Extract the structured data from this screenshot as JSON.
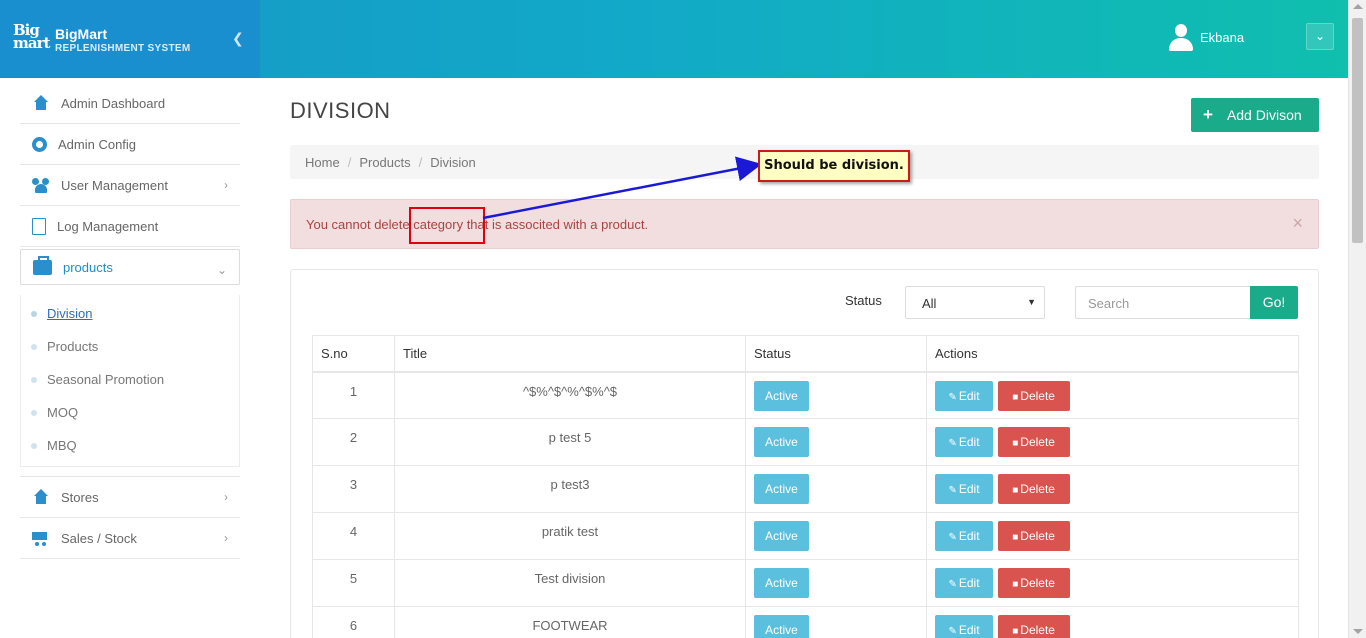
{
  "brand": {
    "logo_top": "Big",
    "logo_bottom": "mart",
    "name": "BigMart",
    "subtitle": "REPLENISHMENT SYSTEM"
  },
  "user": {
    "name": "Ekbana"
  },
  "sidebar": {
    "items": [
      {
        "label": "Admin Dashboard",
        "icon": "home-icon"
      },
      {
        "label": "Admin Config",
        "icon": "gear-icon"
      },
      {
        "label": "User Management",
        "icon": "users-icon"
      },
      {
        "label": "Log Management",
        "icon": "file-icon"
      },
      {
        "label": "products",
        "icon": "briefcase-icon"
      },
      {
        "label": "Stores",
        "icon": "home-icon"
      },
      {
        "label": "Sales / Stock",
        "icon": "cart-icon"
      }
    ],
    "submenu": [
      "Division",
      "Products",
      "Seasonal Promotion",
      "MOQ",
      "MBQ"
    ]
  },
  "page": {
    "title": "DIVISION",
    "add_button": "Add Divison"
  },
  "breadcrumb": [
    "Home",
    "Products",
    "Division"
  ],
  "alert": {
    "message": "You cannot delete category that is associted with a product."
  },
  "filters": {
    "status_label": "Status",
    "status_value": "All",
    "search_placeholder": "Search",
    "go_label": "Go!"
  },
  "table": {
    "headers": [
      "S.no",
      "Title",
      "Status",
      "Actions"
    ],
    "rows": [
      {
        "sno": "1",
        "title": "^$%^$^%^$%^$",
        "status": "Active"
      },
      {
        "sno": "2",
        "title": "p test 5",
        "status": "Active"
      },
      {
        "sno": "3",
        "title": "p test3",
        "status": "Active"
      },
      {
        "sno": "4",
        "title": "pratik test",
        "status": "Active"
      },
      {
        "sno": "5",
        "title": "Test division",
        "status": "Active"
      },
      {
        "sno": "6",
        "title": "FOOTWEAR",
        "status": "Active"
      }
    ],
    "edit_label": "Edit",
    "delete_label": "Delete"
  },
  "annotation": {
    "note": "Should be division."
  },
  "colors": {
    "accent": "#1aab8b",
    "brand": "#1a8fcf",
    "info": "#5bc0de",
    "danger": "#d9534f",
    "alert_bg": "#f2dede",
    "alert_text": "#a94442"
  }
}
